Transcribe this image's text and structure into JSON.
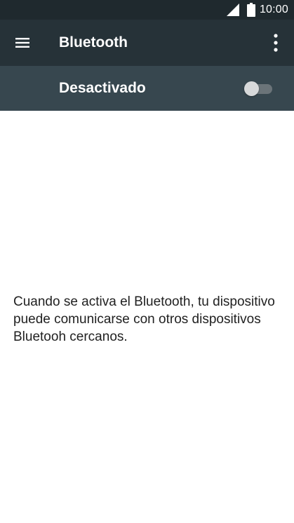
{
  "status_bar": {
    "time": "10:00",
    "icons": [
      "signal-icon",
      "battery-icon"
    ]
  },
  "toolbar": {
    "title": "Bluetooth",
    "menu_icon": "menu-icon",
    "overflow_icon": "more-vert-icon"
  },
  "switch_bar": {
    "label": "Desactivado",
    "switch_state": "off"
  },
  "main": {
    "message": "Cuando se activa el Bluetooth, tu dispositivo puede comunicarse con otros dispositivos Bluetooh cercanos."
  },
  "colors": {
    "status_bar": "#1f292e",
    "toolbar": "#263238",
    "switch_bar": "#37474f",
    "text_primary": "#212121"
  }
}
